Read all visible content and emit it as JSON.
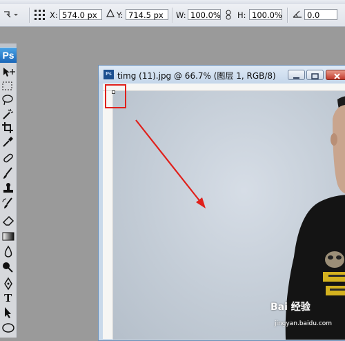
{
  "options_bar": {
    "x_label": "X:",
    "x_value": "574.0 px",
    "y_label": "Y:",
    "y_value": "714.5 px",
    "w_label": "W:",
    "w_value": "100.0%",
    "h_label": "H:",
    "h_value": "100.0%",
    "angle_value": "0.0"
  },
  "toolbox": {
    "logo": "Ps",
    "tools": [
      "move-tool",
      "marquee-tool",
      "lasso-tool",
      "magic-wand-tool",
      "crop-tool",
      "eyedropper-tool",
      "healing-brush-tool",
      "brush-tool",
      "clone-stamp-tool",
      "history-brush-tool",
      "eraser-tool",
      "gradient-tool",
      "blur-tool",
      "dodge-tool",
      "pen-tool",
      "type-tool",
      "path-selection-tool",
      "shape-tool"
    ]
  },
  "document": {
    "icon_text": "Ps",
    "title": "timg (11).jpg @ 66.7% (图层 1, RGB/8)"
  },
  "annotation": {
    "box_color": "#e0201b",
    "arrow_color": "#e0201b"
  },
  "watermark": {
    "main": "Bai 经验",
    "sub": "jingyan.baidu.com"
  }
}
